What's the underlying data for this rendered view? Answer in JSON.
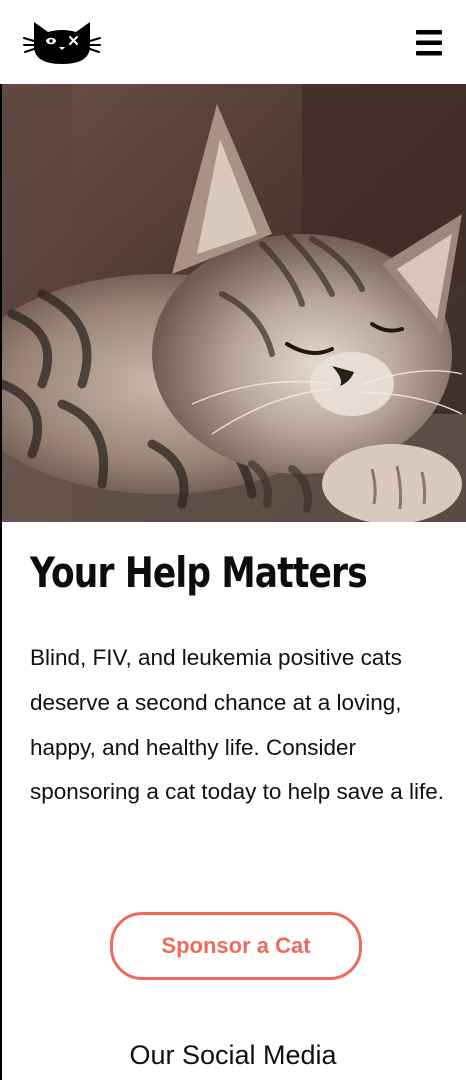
{
  "header": {
    "logo_icon": "cat-face-logo-icon",
    "menu_icon": "hamburger-menu-icon"
  },
  "hero": {
    "image_icon": "sleeping-tabby-kitten-photo"
  },
  "main": {
    "heading": "Your Help Matters",
    "paragraph": "Blind, FIV, and leukemia positive cats deserve a second chance at a loving, happy, and healthy life. Consider sponsoring a cat today to help save a life.",
    "cta_label": "Sponsor a Cat"
  },
  "social": {
    "heading": "Our Social Media"
  },
  "colors": {
    "accent": "#ef6a5a",
    "text": "#111111",
    "background": "#ffffff"
  }
}
